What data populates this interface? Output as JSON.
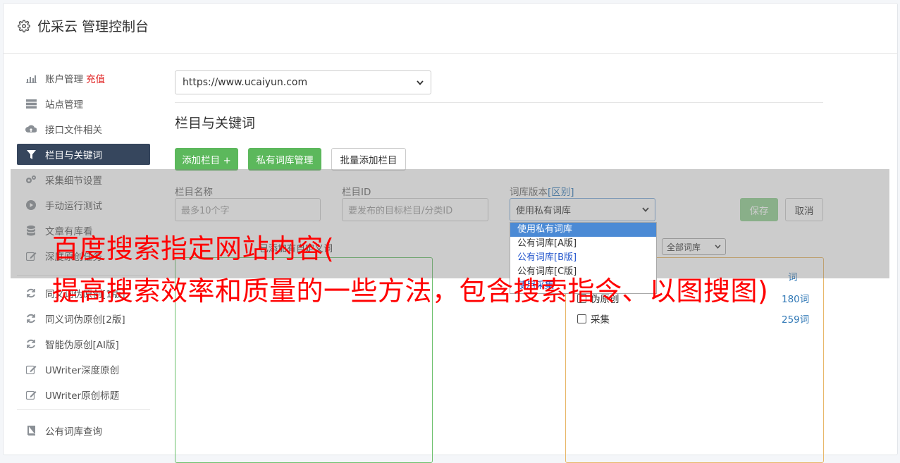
{
  "header": {
    "title": "优采云 管理控制台"
  },
  "sidebar": {
    "items": [
      {
        "label": "账户管理",
        "extra": "充值"
      },
      {
        "label": "站点管理"
      },
      {
        "label": "接口文件相关"
      },
      {
        "label": "栏目与关键词"
      },
      {
        "label": "采集细节设置"
      },
      {
        "label": "手动运行测试"
      },
      {
        "label": "文章有库看"
      },
      {
        "label": "深度原创任务"
      },
      {
        "label": "同义词伪原创[1版]"
      },
      {
        "label": "同义词伪原创[2版]"
      },
      {
        "label": "智能伪原创[AI版]"
      },
      {
        "label": "UWriter深度原创"
      },
      {
        "label": "UWriter原创标题"
      },
      {
        "label": "公有词库查询"
      }
    ]
  },
  "main": {
    "site_select": "https://www.ucaiyun.com",
    "section_title": "栏目与关键词",
    "buttons": {
      "add_column": "添加栏目 +",
      "private_lib": "私有词库管理",
      "batch_add": "批量添加栏目"
    },
    "form": {
      "name_label": "栏目名称",
      "name_placeholder": "最多10个字",
      "id_label": "栏目ID",
      "id_placeholder": "要发布的目标栏目/分类ID",
      "version_label": "词库版本",
      "version_link": "[区别]",
      "version_value": "使用私有词库",
      "save": "保存",
      "cancel": "取消"
    },
    "dropdown_options": [
      "使用私有词库",
      "公有词库[A版]",
      "公有词库[B版]",
      "公有词库[C版]",
      "使用采集"
    ],
    "left_panel_title": "已添加有自定义词",
    "right_filter": "全部词库",
    "right_list": [
      {
        "label": "伪原创",
        "count": "180词"
      },
      {
        "label": "采集",
        "count": "259词"
      }
    ],
    "right_partial_count": "词"
  },
  "overlay": {
    "line1": "百度搜索指定网站内容(",
    "line2": "提高搜索效率和质量的一些方法，包含搜索指令、以图搜图)"
  },
  "colors": {
    "accent_green": "#5cb85c",
    "sidebar_active": "#36465d",
    "link_red": "#e02020",
    "headline_red": "#ff0000"
  }
}
